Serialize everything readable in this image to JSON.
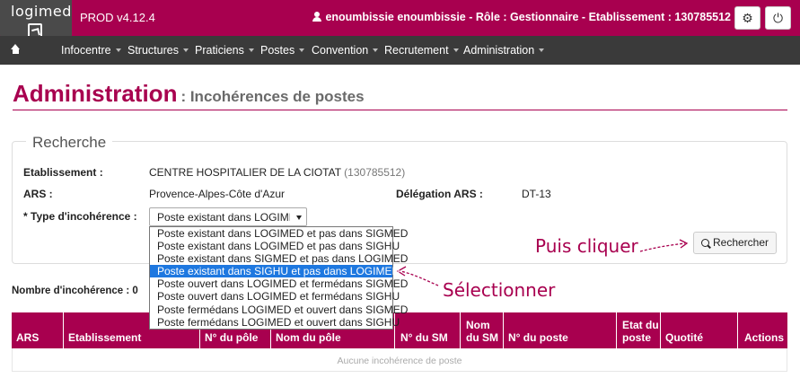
{
  "app": {
    "logo_text": "logimed",
    "version": "PROD v4.12.4",
    "user_info": "enoumbissie enoumbissie - Rôle : Gestionnaire - Etablissement : 130785512"
  },
  "nav": {
    "items": [
      {
        "label": "Infocentre"
      },
      {
        "label": "Structures"
      },
      {
        "label": "Praticiens"
      },
      {
        "label": "Postes"
      },
      {
        "label": "Convention"
      },
      {
        "label": "Recrutement"
      },
      {
        "label": "Administration"
      }
    ]
  },
  "page": {
    "title": "Administration",
    "subtitle": ": Incohérences de postes"
  },
  "search": {
    "legend": "Recherche",
    "etablissement_label": "Etablissement :",
    "etablissement_value": "CENTRE HOSPITALIER DE LA CIOTAT",
    "etablissement_code": "(130785512)",
    "ars_label": "ARS :",
    "ars_value": "Provence-Alpes-Côte d'Azur",
    "delegation_label": "Délégation ARS :",
    "delegation_value": "DT-13",
    "type_label": "* Type d'incohérence :",
    "type_selected": "Poste existant dans LOGIMED et pas dans SIGMED",
    "type_options": [
      "Poste existant dans LOGIMED et pas dans SIGMED",
      "Poste existant dans LOGIMED et pas dans SIGHU",
      "Poste existant dans SIGMED et pas dans LOGIMED",
      "Poste existant dans SIGHU et pas dans LOGIMED",
      "Poste ouvert dans LOGIMED et fermédans SIGMED",
      "Poste ouvert dans LOGIMED et fermédans SIGHU",
      "Poste fermédans LOGIMED et ouvert dans SIGMED",
      "Poste fermédans LOGIMED et ouvert dans SIGHU"
    ],
    "highlighted_option_index": 3,
    "search_button": "Rechercher"
  },
  "annotations": {
    "click": "Puis cliquer",
    "select": "Sélectionner"
  },
  "results": {
    "count_label": "Nombre d'incohérence :",
    "count": "0",
    "columns": [
      "ARS",
      "Etablissement",
      "N° du pôle",
      "Nom du pôle",
      "N° du SM",
      "Nom du SM",
      "N° du poste",
      "Etat du poste",
      "Quotité",
      "Actions"
    ],
    "empty_message": "Aucune incohérence de poste"
  },
  "colors": {
    "brand": "#a8004f",
    "nav_bg": "#3a3a3a",
    "selection": "#1e78e0"
  }
}
